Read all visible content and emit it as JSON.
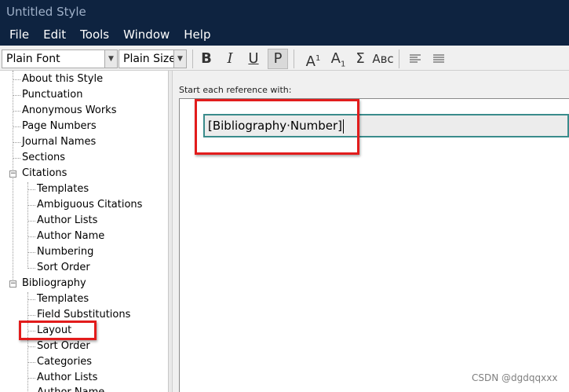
{
  "window": {
    "title": "Untitled Style"
  },
  "menubar": {
    "items": [
      "File",
      "Edit",
      "Tools",
      "Window",
      "Help"
    ]
  },
  "toolbar": {
    "font_value": "Plain Font",
    "size_value": "Plain Size",
    "bold": "B",
    "italic": "I",
    "underline": "U",
    "plain": "P",
    "superscript_base": "A",
    "superscript_mark": "1",
    "subscript_base": "A",
    "subscript_mark": "1",
    "symbol": "Σ",
    "smallcaps": "Aʙᴄ"
  },
  "tree": {
    "items": [
      {
        "label": "About this Style"
      },
      {
        "label": "Punctuation"
      },
      {
        "label": "Anonymous Works"
      },
      {
        "label": "Page Numbers"
      },
      {
        "label": "Journal Names"
      },
      {
        "label": "Sections"
      },
      {
        "label": "Citations",
        "expander": "−"
      },
      {
        "label": "Templates"
      },
      {
        "label": "Ambiguous Citations"
      },
      {
        "label": "Author Lists"
      },
      {
        "label": "Author Name"
      },
      {
        "label": "Numbering"
      },
      {
        "label": "Sort Order"
      },
      {
        "label": "Bibliography",
        "expander": "−"
      },
      {
        "label": "Templates"
      },
      {
        "label": "Field Substitutions"
      },
      {
        "label": "Layout"
      },
      {
        "label": "Sort Order"
      },
      {
        "label": "Categories"
      },
      {
        "label": "Author Lists"
      },
      {
        "label": "Author Name"
      }
    ]
  },
  "layout_panel": {
    "section_label": "Start each reference with:",
    "reference_prefix": "[Bibliography·Number]"
  },
  "watermark": "CSDN @dgdqqxxx",
  "colors": {
    "titlebar": "#0e2340",
    "highlight": "#e21c1c",
    "input_border": "#3a8c8c"
  }
}
